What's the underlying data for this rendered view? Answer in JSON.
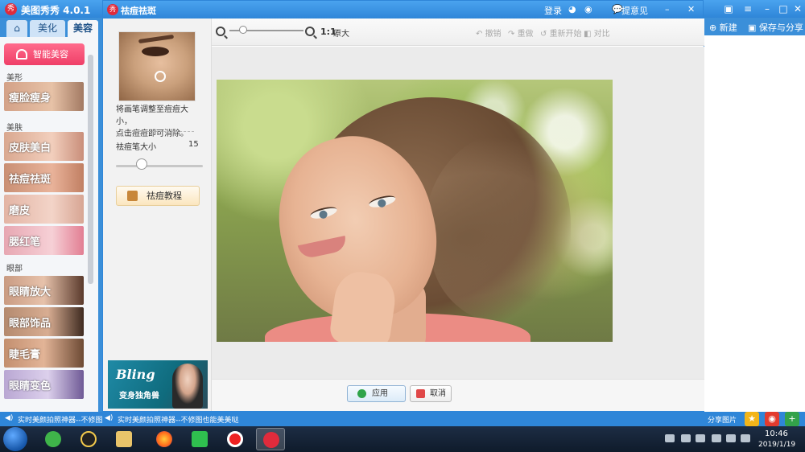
{
  "app": {
    "title": "美图秀秀 4.0.1",
    "logo_text": "秀",
    "tabs": [
      {
        "label": "美化"
      },
      {
        "label": "美容"
      }
    ],
    "smart_button_label": "智能美容",
    "sections": {
      "shape": "美形",
      "skin": "美肤",
      "eyes": "眼部"
    },
    "tools": [
      {
        "label": "瘦脸瘦身"
      },
      {
        "label": "皮肤美白"
      },
      {
        "label": "祛痘祛斑"
      },
      {
        "label": "磨皮"
      },
      {
        "label": "腮红笔"
      },
      {
        "label": "眼睛放大"
      },
      {
        "label": "眼部饰品"
      },
      {
        "label": "睫毛膏"
      },
      {
        "label": "眼睛变色"
      }
    ],
    "login_label": "登录",
    "feedback_label": "提意见",
    "new_label": "新建",
    "save_share_label": "保存与分享",
    "share_pictures_label": "分享图片"
  },
  "dialog": {
    "title": "祛痘祛斑",
    "hint_line1": "将画笔调整至痘痘大小，",
    "hint_line2": "点击痘痘即可消除。",
    "brush_size_label": "祛痘笔大小",
    "brush_size_value": "15",
    "brush_size_level": 0.3,
    "tutorial_label": "祛痘教程",
    "ad_title": "Bling",
    "ad_subtitle": "变身独角兽",
    "toolbar": {
      "zoom_level": 0.18,
      "zoom_11": "1:1",
      "zoom_original": "原大",
      "undo": "撤销",
      "redo": "重做",
      "restart": "重新开始",
      "compare": "对比"
    },
    "apply_label": "应用",
    "cancel_label": "取消"
  },
  "status_bar": {
    "ticker1": "实时美颜拍照神器--不修图",
    "ticker2": "实时美颜拍照神器--不修图也能美美哒"
  },
  "taskbar": {
    "time": "10:46",
    "date": "2019/1/19"
  },
  "colors": {
    "accent": "#2f86d8",
    "smart_button": "#ef3f68",
    "apply_icon": "#2fa44a"
  }
}
